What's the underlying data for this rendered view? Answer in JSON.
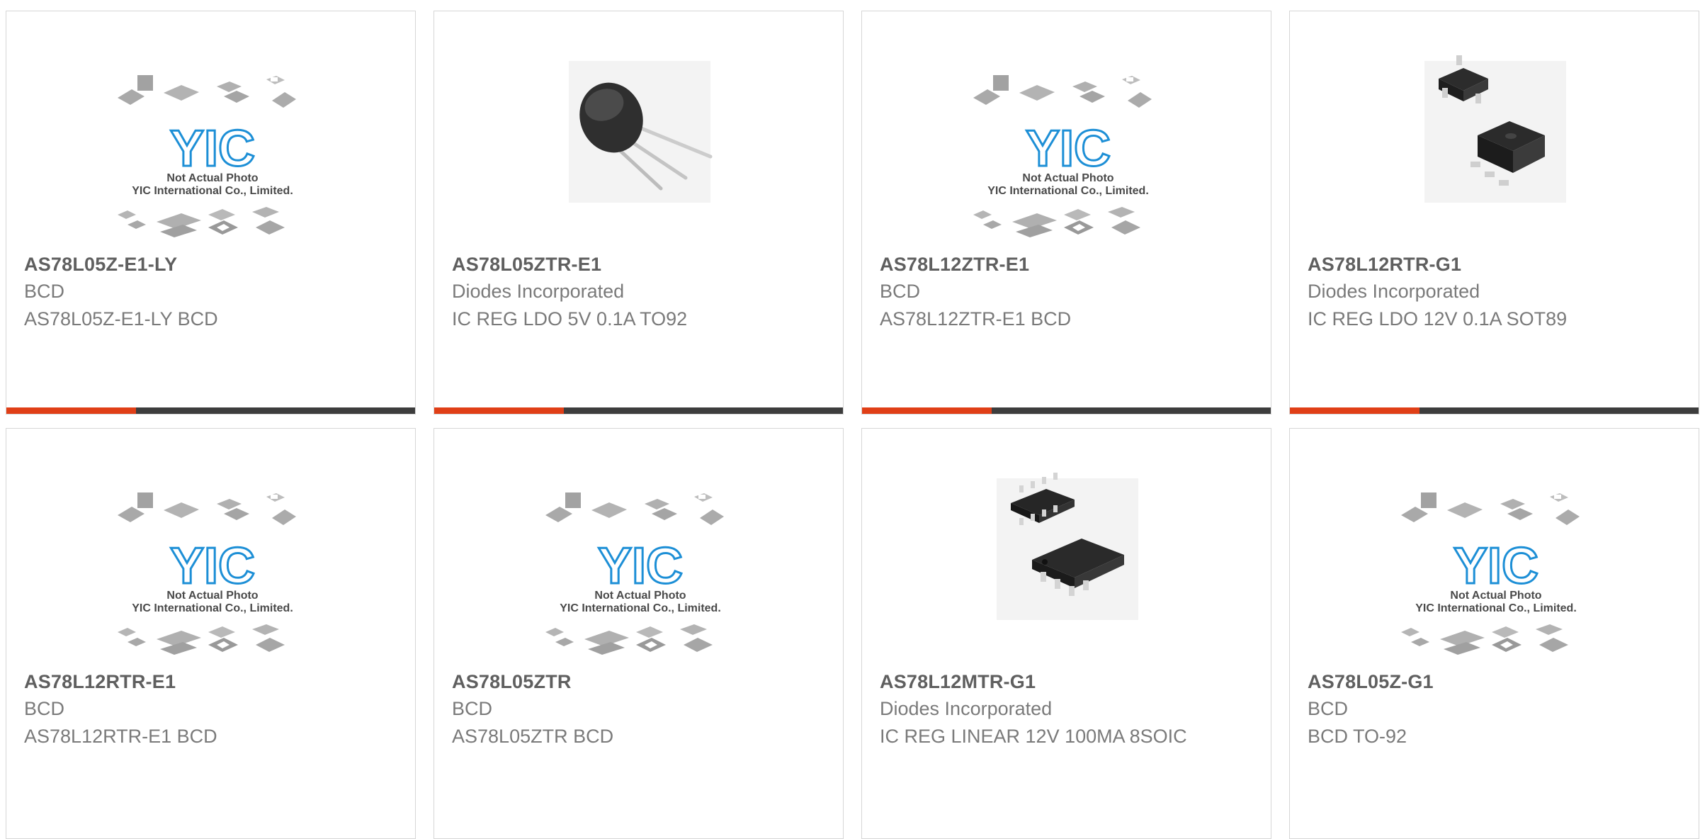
{
  "colors": {
    "accent": "#e03f17",
    "bar": "#3d3d3d",
    "border": "#d6d6d6",
    "title": "#5f5f5f",
    "text": "#7a7a7a",
    "logo": "#1d8fd6"
  },
  "placeholder": {
    "line1": "Not Actual Photo",
    "line2": "YIC International Co., Limited.",
    "logo_text": "YIC"
  },
  "products": [
    {
      "part": "AS78L05Z-E1-LY",
      "manufacturer": "BCD",
      "description": "AS78L05Z-E1-LY BCD",
      "image": "placeholder-logo",
      "accent_bar": true
    },
    {
      "part": "AS78L05ZTR-E1",
      "manufacturer": "Diodes Incorporated",
      "description": "IC REG LDO 5V 0.1A TO92",
      "image": "to92-package",
      "accent_bar": true
    },
    {
      "part": "AS78L12ZTR-E1",
      "manufacturer": "BCD",
      "description": "AS78L12ZTR-E1 BCD",
      "image": "placeholder-logo",
      "accent_bar": true
    },
    {
      "part": "AS78L12RTR-G1",
      "manufacturer": "Diodes Incorporated",
      "description": "IC REG LDO 12V 0.1A SOT89",
      "image": "sot89-package",
      "accent_bar": true
    },
    {
      "part": "AS78L12RTR-E1",
      "manufacturer": "BCD",
      "description": "AS78L12RTR-E1 BCD",
      "image": "placeholder-logo",
      "accent_bar": false
    },
    {
      "part": "AS78L05ZTR",
      "manufacturer": "BCD",
      "description": "AS78L05ZTR BCD",
      "image": "placeholder-logo",
      "accent_bar": false
    },
    {
      "part": "AS78L12MTR-G1",
      "manufacturer": "Diodes Incorporated",
      "description": "IC REG LINEAR 12V 100MA 8SOIC",
      "image": "soic8-package",
      "accent_bar": false
    },
    {
      "part": "AS78L05Z-G1",
      "manufacturer": "BCD",
      "description": "BCD TO-92",
      "image": "placeholder-logo",
      "accent_bar": false
    }
  ]
}
